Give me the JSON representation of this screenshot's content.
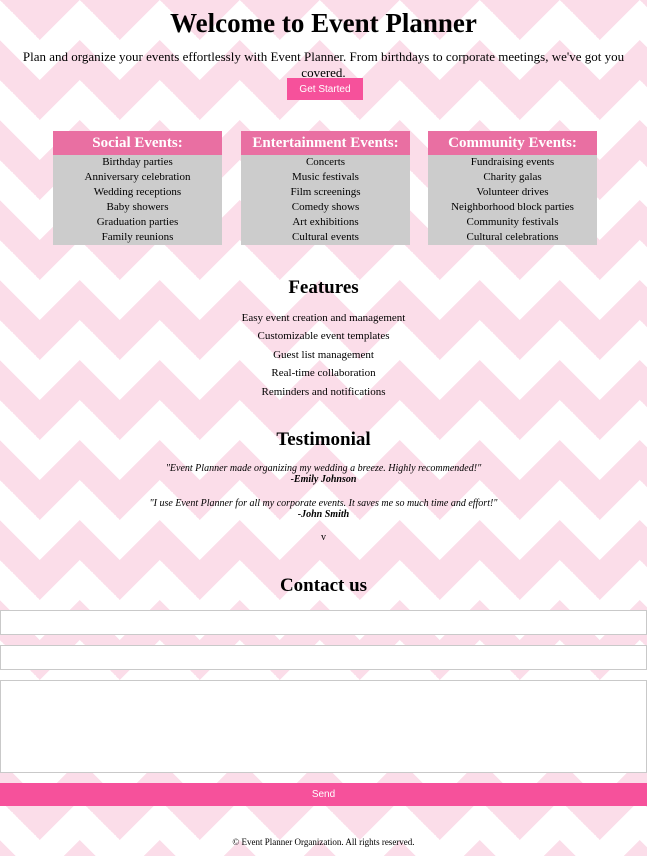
{
  "header": {
    "title": "Welcome to Event Planner",
    "intro": "Plan and organize your events effortlessly with Event Planner. From birthdays to corporate meetings, we've got you covered.",
    "cta_label": "Get Started"
  },
  "categories": [
    {
      "title": "Social Events:",
      "items": [
        "Birthday parties",
        "Anniversary celebration",
        "Wedding receptions",
        "Baby showers",
        "Graduation parties",
        "Family reunions"
      ]
    },
    {
      "title": "Entertainment Events:",
      "items": [
        "Concerts",
        "Music festivals",
        "Film screenings",
        "Comedy shows",
        "Art exhibitions",
        "Cultural events"
      ]
    },
    {
      "title": "Community Events:",
      "items": [
        "Fundraising events",
        "Charity galas",
        "Volunteer drives",
        "Neighborhood block parties",
        "Community festivals",
        "Cultural celebrations"
      ]
    }
  ],
  "features": {
    "title": "Features",
    "items": [
      "Easy event creation and management",
      "Customizable event templates",
      "Guest list management",
      "Real-time collaboration",
      "Reminders and notifications"
    ]
  },
  "testimonial": {
    "title": "Testimonial",
    "quotes": [
      {
        "text": "\"Event Planner made organizing my wedding a breeze. Highly recommended!\"",
        "author": "-Emily Johnson"
      },
      {
        "text": "\"I use Event Planner for all my corporate events. It saves me so much time and effort!\"",
        "author": "-John Smith"
      }
    ],
    "stray_text": "v"
  },
  "contact": {
    "title": "Contact us",
    "name_value": "",
    "email_value": "",
    "message_value": "",
    "send_label": "Send"
  },
  "footer": {
    "text": "© Event Planner Organization. All rights reserved."
  },
  "colors": {
    "accent": "#f6519b",
    "card_header": "#e96fa2",
    "card_body": "#cccccc",
    "chevron": "#fbdde9"
  }
}
